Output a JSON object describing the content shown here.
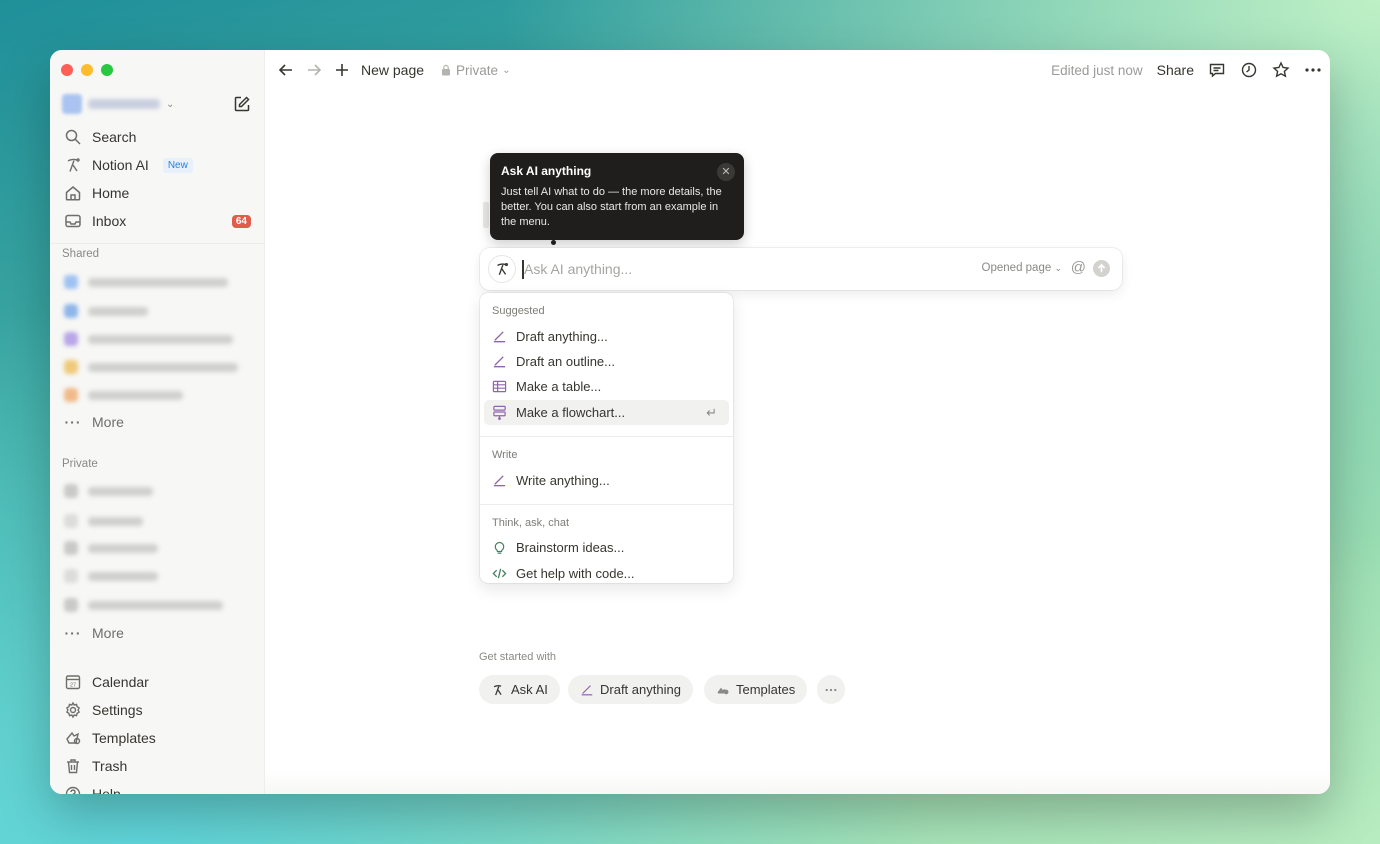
{
  "sidebar": {
    "nav": [
      {
        "label": "Search",
        "icon": "search-icon"
      },
      {
        "label": "Notion AI",
        "icon": "notion-ai-icon",
        "badge": "New"
      },
      {
        "label": "Home",
        "icon": "home-icon"
      },
      {
        "label": "Inbox",
        "icon": "inbox-icon",
        "count": "64"
      }
    ],
    "shared_title": "Shared",
    "private_title": "Private",
    "more_label": "More",
    "bottom": [
      {
        "label": "Calendar",
        "icon": "calendar-icon"
      },
      {
        "label": "Settings",
        "icon": "settings-icon"
      },
      {
        "label": "Templates",
        "icon": "templates-icon"
      },
      {
        "label": "Trash",
        "icon": "trash-icon"
      },
      {
        "label": "Help",
        "icon": "help-icon"
      }
    ]
  },
  "topbar": {
    "new_page": "New page",
    "privacy": "Private",
    "edited": "Edited just now",
    "share": "Share"
  },
  "tooltip": {
    "title": "Ask AI anything",
    "body": "Just tell AI what to do — the more details, the better. You can also start from an example in the menu."
  },
  "ai_input": {
    "placeholder": "Ask AI anything...",
    "context": "Opened page"
  },
  "menu": {
    "suggested_title": "Suggested",
    "suggested": [
      "Draft anything...",
      "Draft an outline...",
      "Make a table...",
      "Make a flowchart..."
    ],
    "write_title": "Write",
    "write": [
      "Write anything..."
    ],
    "think_title": "Think, ask, chat",
    "think": [
      "Brainstorm ideas...",
      "Get help with code..."
    ]
  },
  "get_started": {
    "title": "Get started with",
    "chips": [
      "Ask AI",
      "Draft anything",
      "Templates"
    ]
  },
  "colors": {
    "accent_purple": "#9065b0",
    "inbox_badge": "#e05c4b",
    "green_icon": "#448361"
  }
}
